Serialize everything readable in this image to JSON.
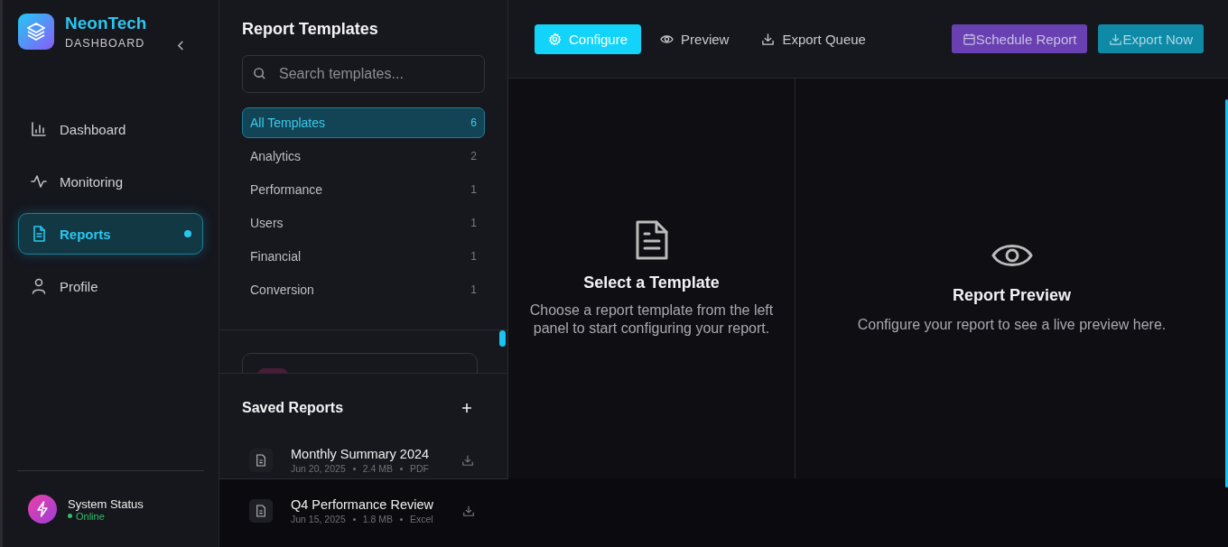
{
  "sidebar": {
    "brand": {
      "name": "NeonTech",
      "subtitle": "DASHBOARD"
    },
    "items": [
      {
        "label": "Dashboard",
        "selected": false
      },
      {
        "label": "Monitoring",
        "selected": false
      },
      {
        "label": "Reports",
        "selected": true
      },
      {
        "label": "Profile",
        "selected": false
      }
    ],
    "status": {
      "title": "System Status",
      "state": "Online"
    }
  },
  "templates": {
    "title": "Report Templates",
    "search": {
      "placeholder": "Search templates..."
    },
    "categories": [
      {
        "label": "All Templates",
        "count": "6",
        "selected": true
      },
      {
        "label": "Analytics",
        "count": "2",
        "selected": false
      },
      {
        "label": "Performance",
        "count": "1",
        "selected": false
      },
      {
        "label": "Users",
        "count": "1",
        "selected": false
      },
      {
        "label": "Financial",
        "count": "1",
        "selected": false
      },
      {
        "label": "Conversion",
        "count": "1",
        "selected": false
      }
    ]
  },
  "saved_reports": {
    "title": "Saved Reports",
    "items": [
      {
        "name": "Monthly Summary 2024",
        "date": "Jun 20, 2025",
        "size": "2.4 MB",
        "format": "PDF"
      },
      {
        "name": "Q4 Performance Review",
        "date": "Jun 15, 2025",
        "size": "1.8 MB",
        "format": "Excel"
      }
    ]
  },
  "toolbar": {
    "tabs": [
      {
        "label": "Configure",
        "selected": true
      },
      {
        "label": "Preview",
        "selected": false
      },
      {
        "label": "Export Queue",
        "selected": false
      }
    ],
    "actions": [
      {
        "label": "Schedule Report",
        "kind": "schedule"
      },
      {
        "label": "Export Now",
        "kind": "export"
      }
    ]
  },
  "panes": [
    {
      "title": "Select a Template",
      "text": "Choose a report template from the left panel to start configuring your report."
    },
    {
      "title": "Report Preview",
      "text": "Configure your report to see a live preview here."
    }
  ]
}
